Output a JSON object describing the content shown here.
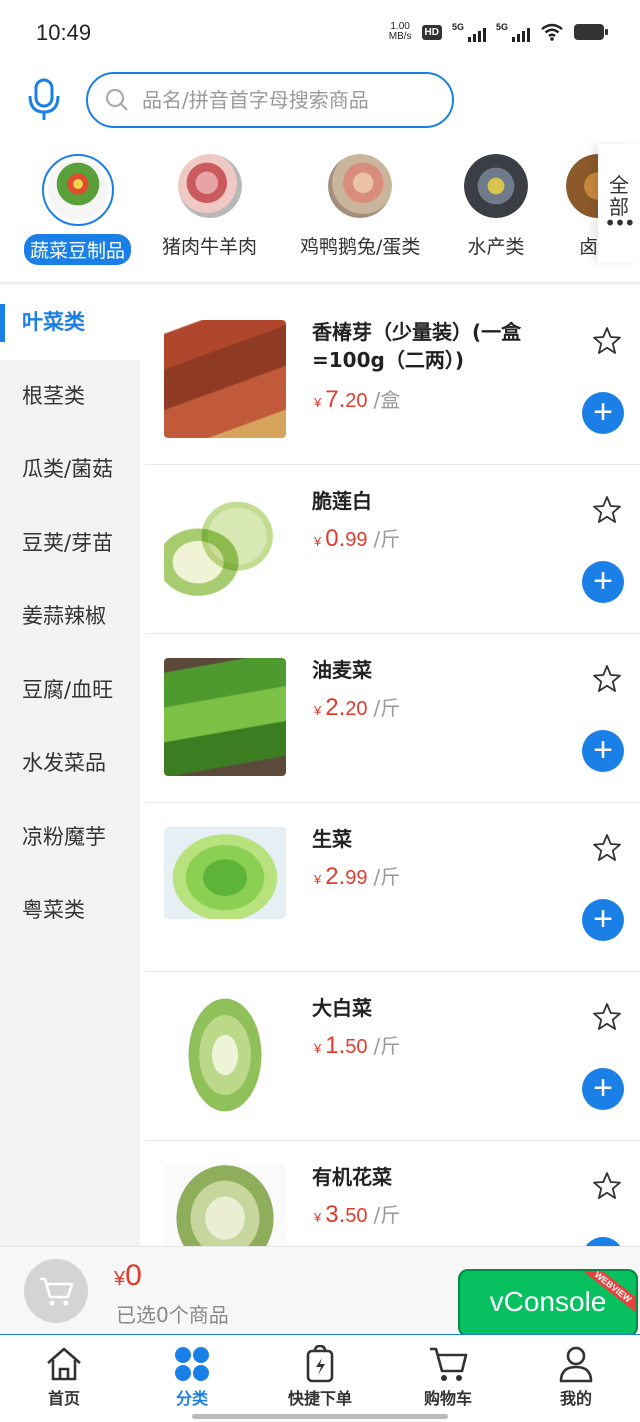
{
  "status_bar": {
    "time": "10:49",
    "net_speed_value": "1.00",
    "net_speed_unit": "MB/s",
    "hd_label": "HD",
    "signal1_label": "5G",
    "signal2_label": "5G"
  },
  "search": {
    "placeholder": "品名/拼音首字母搜索商品",
    "icons": [
      "microphone-icon",
      "search-icon"
    ]
  },
  "categories": {
    "items": [
      {
        "label": "蔬菜豆制品",
        "active": true
      },
      {
        "label": "猪肉牛羊肉",
        "active": false
      },
      {
        "label": "鸡鸭鹅兔/蛋类",
        "active": false
      },
      {
        "label": "水产类",
        "active": false
      },
      {
        "label": "卤制",
        "active": false
      }
    ],
    "all_label": "全部",
    "all_dots": "•••"
  },
  "sidebar": {
    "items": [
      {
        "label": "叶菜类",
        "active": true
      },
      {
        "label": "根茎类"
      },
      {
        "label": "瓜类/菌菇"
      },
      {
        "label": "豆荚/芽苗"
      },
      {
        "label": "姜蒜辣椒"
      },
      {
        "label": "豆腐/血旺"
      },
      {
        "label": "水发菜品"
      },
      {
        "label": "凉粉魔芋"
      },
      {
        "label": "粤菜类"
      }
    ]
  },
  "products": [
    {
      "name": "香椿芽（少量装）(一盒=100g（二两）)",
      "currency": "¥",
      "price_int": "7.",
      "price_dec": "20",
      "unit": "/盒"
    },
    {
      "name": "脆莲白",
      "currency": "¥",
      "price_int": "0.",
      "price_dec": "99",
      "unit": "/斤"
    },
    {
      "name": "油麦菜",
      "currency": "¥",
      "price_int": "2.",
      "price_dec": "20",
      "unit": "/斤"
    },
    {
      "name": "生菜",
      "currency": "¥",
      "price_int": "2.",
      "price_dec": "99",
      "unit": "/斤"
    },
    {
      "name": "大白菜",
      "currency": "¥",
      "price_int": "1.",
      "price_dec": "50",
      "unit": "/斤"
    },
    {
      "name": "有机花菜",
      "currency": "¥",
      "price_int": "3.",
      "price_dec": "50",
      "unit": "/斤"
    }
  ],
  "cart": {
    "currency": "¥",
    "total": "0",
    "selected_text": "已选0个商品",
    "vconsole_label": "vConsole",
    "vconsole_ribbon": "WEBVIEW"
  },
  "tabbar": {
    "tabs": [
      {
        "label": "首页",
        "icon": "home-icon",
        "active": false
      },
      {
        "label": "分类",
        "icon": "category-icon",
        "active": true
      },
      {
        "label": "快捷下单",
        "icon": "quick-order-icon",
        "active": false
      },
      {
        "label": "购物车",
        "icon": "cart-icon",
        "active": false
      },
      {
        "label": "我的",
        "icon": "user-icon",
        "active": false
      }
    ]
  },
  "colors": {
    "accent": "#1a7fe6",
    "price": "#e23b2e",
    "vconsole": "#07c160"
  }
}
